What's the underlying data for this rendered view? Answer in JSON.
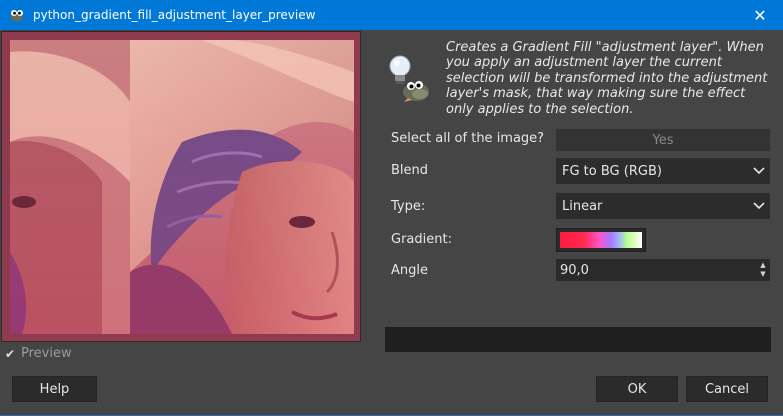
{
  "window": {
    "title": "python_gradient_fill_adjustment_layer_preview",
    "close_glyph": "✕",
    "app_icon": "gimp-wilber-icon"
  },
  "preview": {
    "image": "portrait-photo-with-pink-gradient-overlay",
    "checkbox_label": "Preview",
    "checked": true
  },
  "description": {
    "icon": "lightbulb-wilber-icon",
    "text": "Creates a Gradient Fill \"adjustment layer\". When you apply an adjustment layer the current selection will be transformed into the adjustment layer's mask, that way making sure the effect only applies to the selection."
  },
  "form": {
    "select_all": {
      "label": "Select all of the image?",
      "value": "Yes"
    },
    "blend": {
      "label": "Blend",
      "value": "FG to BG (RGB)"
    },
    "type": {
      "label": "Type:",
      "value": "Linear"
    },
    "gradient": {
      "label": "Gradient:",
      "colors": [
        "#ff1a3c",
        "#ff55c8",
        "#a777ff",
        "#b8ff8a",
        "#ffffff"
      ]
    },
    "angle": {
      "label": "Angle",
      "value": "90,0"
    }
  },
  "progress": {
    "fraction": 0
  },
  "buttons": {
    "help": "Help",
    "ok": "OK",
    "cancel": "Cancel"
  },
  "colors": {
    "titlebar": "#0078d7",
    "dialog_bg": "#454545",
    "field_bg": "#2c2c2c"
  }
}
